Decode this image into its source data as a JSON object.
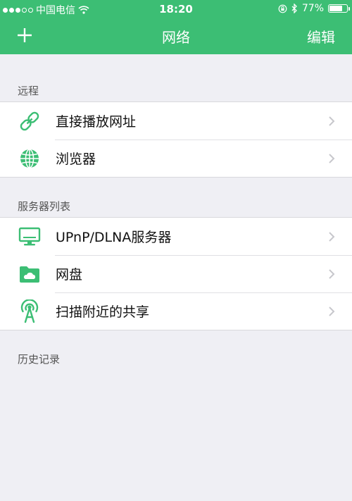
{
  "status_bar": {
    "carrier": "中国电信",
    "time": "18:20",
    "battery_text": "77%",
    "battery_level": 0.77
  },
  "nav": {
    "add_icon": "plus-icon",
    "title": "网络",
    "edit_label": "编辑"
  },
  "sections": {
    "remote": {
      "label": "远程",
      "items": [
        {
          "label": "直接播放网址",
          "icon": "link-icon"
        },
        {
          "label": "浏览器",
          "icon": "globe-icon"
        }
      ]
    },
    "servers": {
      "label": "服务器列表",
      "items": [
        {
          "label": "UPnP/DLNA服务器",
          "icon": "monitor-icon"
        },
        {
          "label": "网盘",
          "icon": "cloud-folder-icon"
        },
        {
          "label": "扫描附近的共享",
          "icon": "antenna-icon"
        }
      ]
    },
    "history": {
      "label": "历史记录"
    }
  },
  "colors": {
    "accent": "#3cbe74",
    "background": "#efeff4",
    "chevron": "#c7c7cc"
  }
}
